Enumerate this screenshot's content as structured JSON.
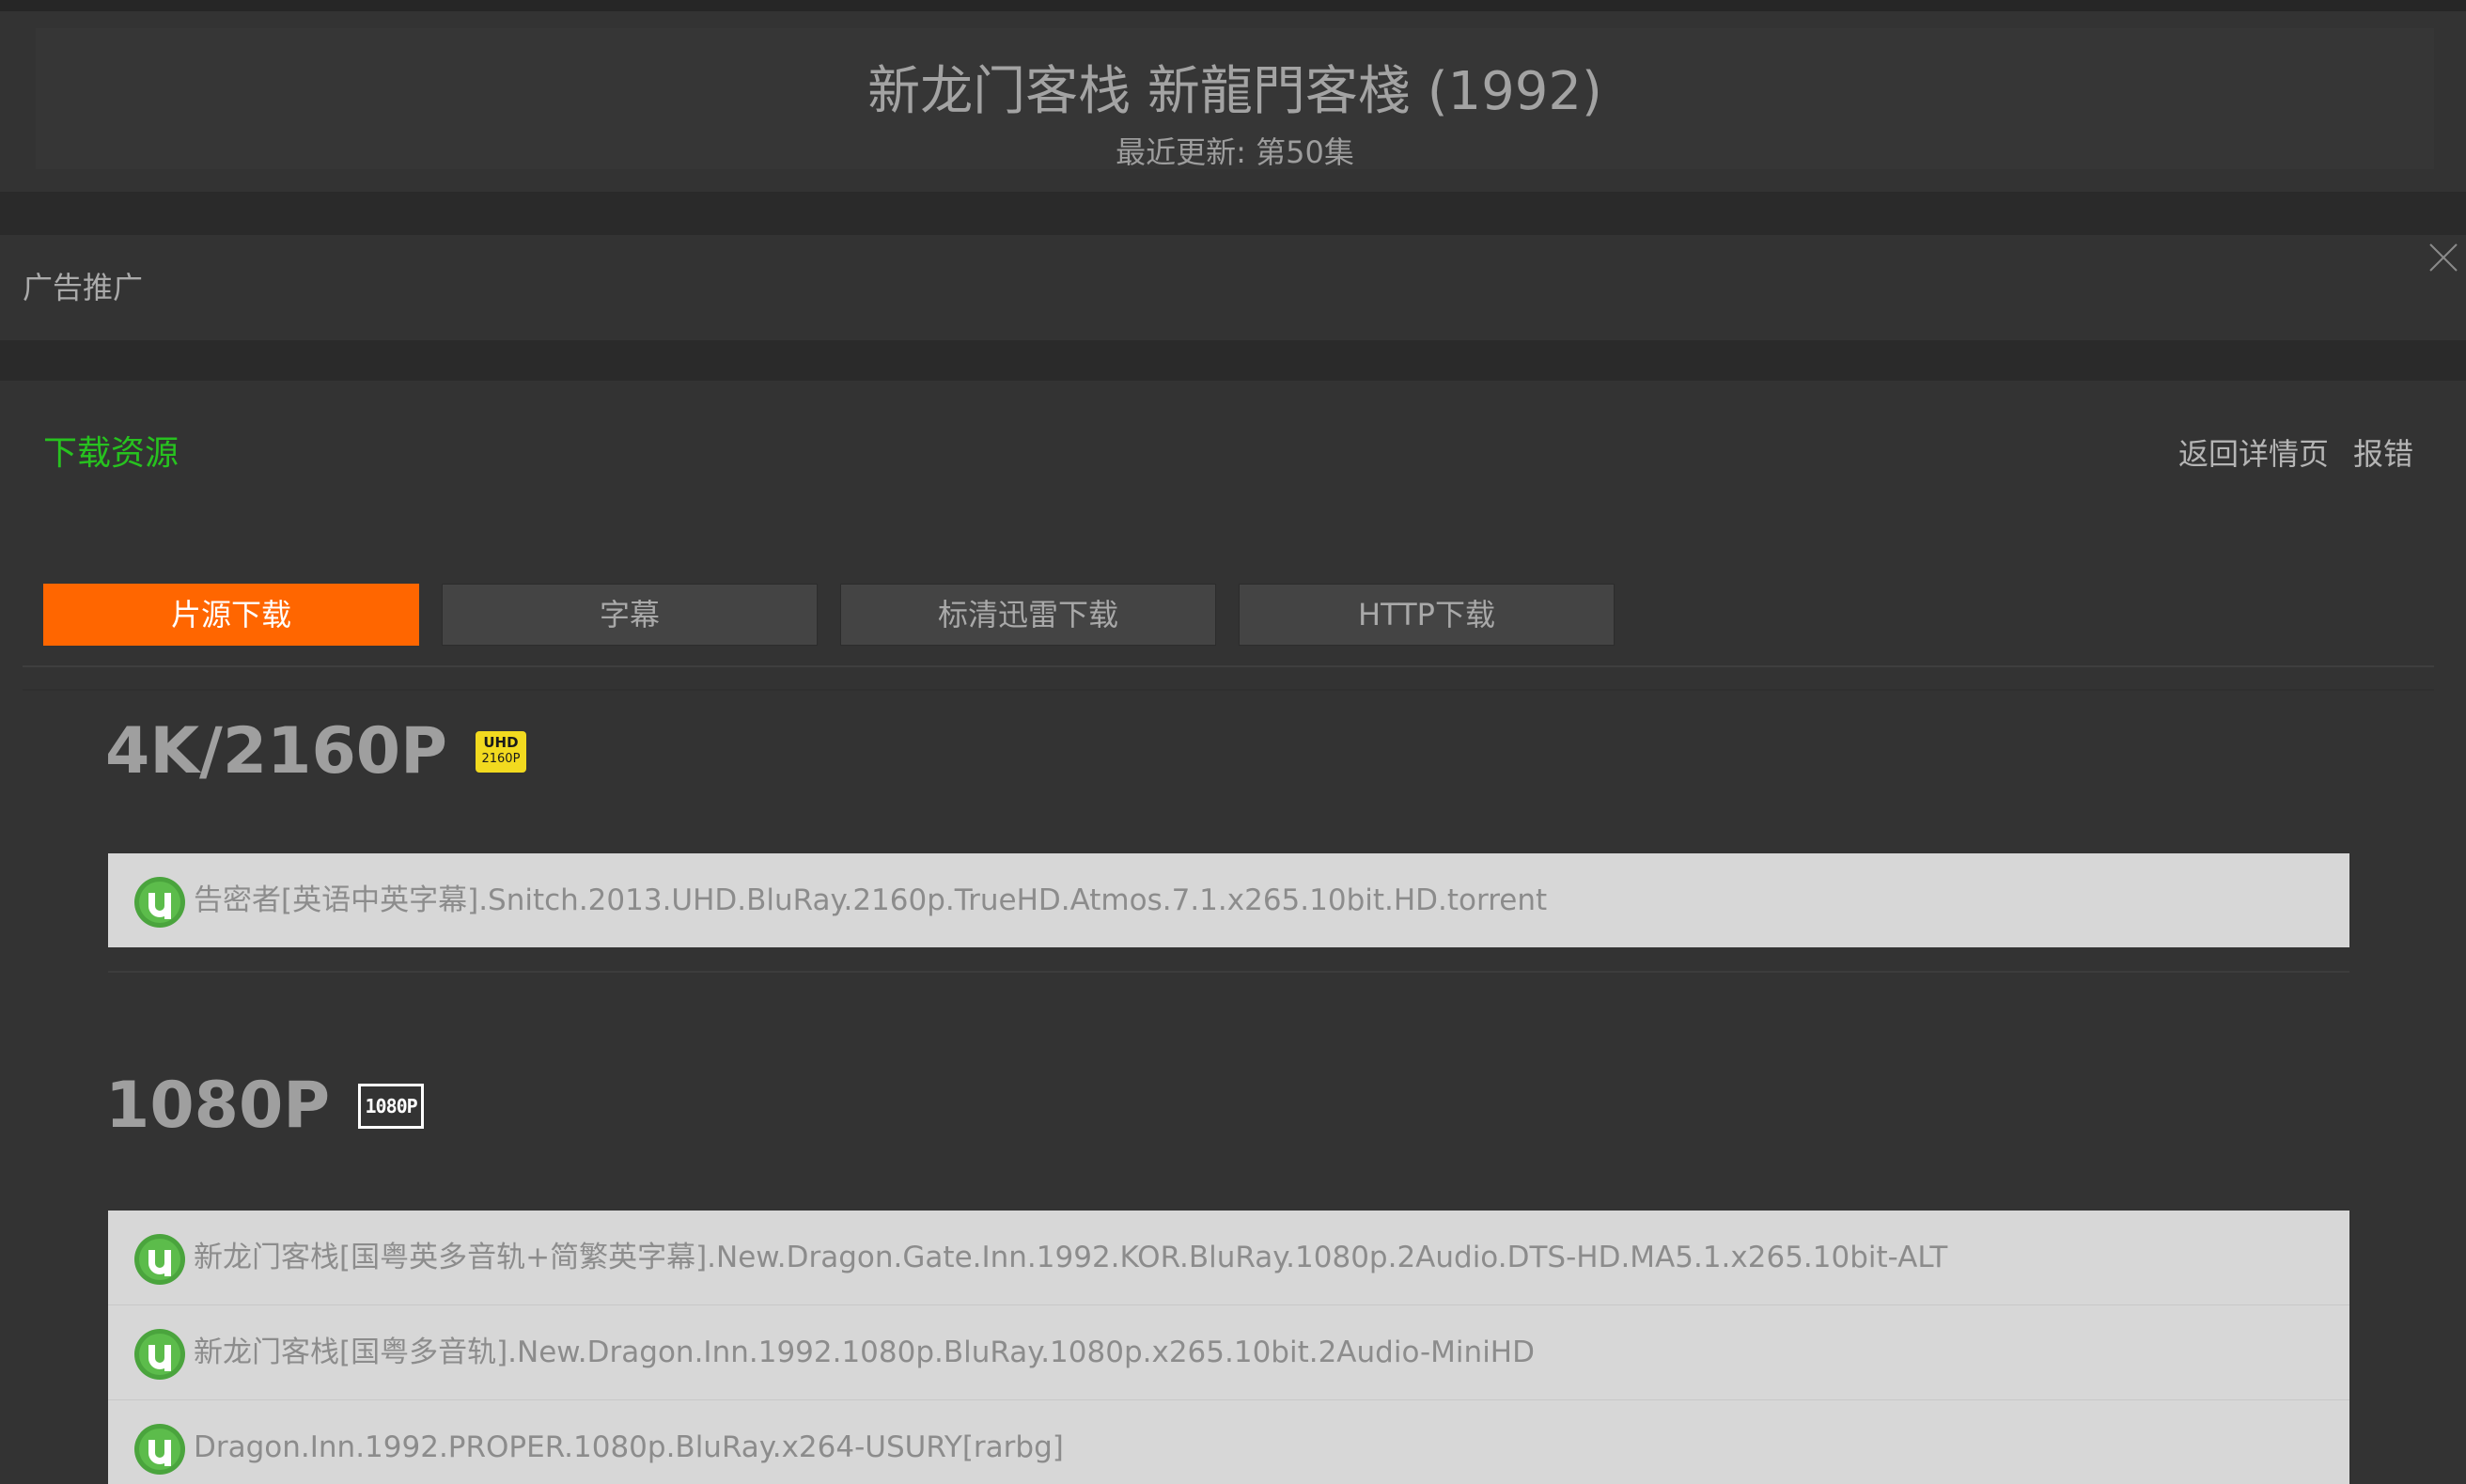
{
  "header": {
    "title": "新龙门客栈 新龍門客棧 (1992)",
    "latest_update": "最近更新: 第50集"
  },
  "ad": {
    "label": "广告推广",
    "close_icon": "close-icon"
  },
  "download": {
    "section_title": "下载资源",
    "links": {
      "back": "返回详情页",
      "report": "报错"
    },
    "tabs": [
      {
        "label": "片源下载",
        "active": true
      },
      {
        "label": "字幕",
        "active": false
      },
      {
        "label": "标清迅雷下载",
        "active": false
      },
      {
        "label": "HTTP下载",
        "active": false
      }
    ],
    "accent_color": "#ff6600",
    "title_color": "#27c21f"
  },
  "qualities": [
    {
      "label": "4K/2160P",
      "badge": {
        "line1": "UHD",
        "line2": "2160P",
        "color": "#f2da1f"
      },
      "items": [
        {
          "icon": "utorrent-icon",
          "name": "告密者[英语中英字幕].Snitch.2013.UHD.BluRay.2160p.TrueHD.Atmos.7.1.x265.10bit.HD.torrent"
        }
      ]
    },
    {
      "label": "1080P",
      "badge": {
        "text": "1080P"
      },
      "items": [
        {
          "icon": "utorrent-icon",
          "name": "新龙门客栈[国粤英多音轨+简繁英字幕].New.Dragon.Gate.Inn.1992.KOR.BluRay.1080p.2Audio.DTS-HD.MA5.1.x265.10bit-ALT"
        },
        {
          "icon": "utorrent-icon",
          "name": "新龙门客栈[国粤多音轨].New.Dragon.Inn.1992.1080p.BluRay.1080p.x265.10bit.2Audio-MiniHD"
        },
        {
          "icon": "utorrent-icon",
          "name": "Dragon.Inn.1992.PROPER.1080p.BluRay.x264-USURY[rarbg]"
        }
      ]
    }
  ]
}
